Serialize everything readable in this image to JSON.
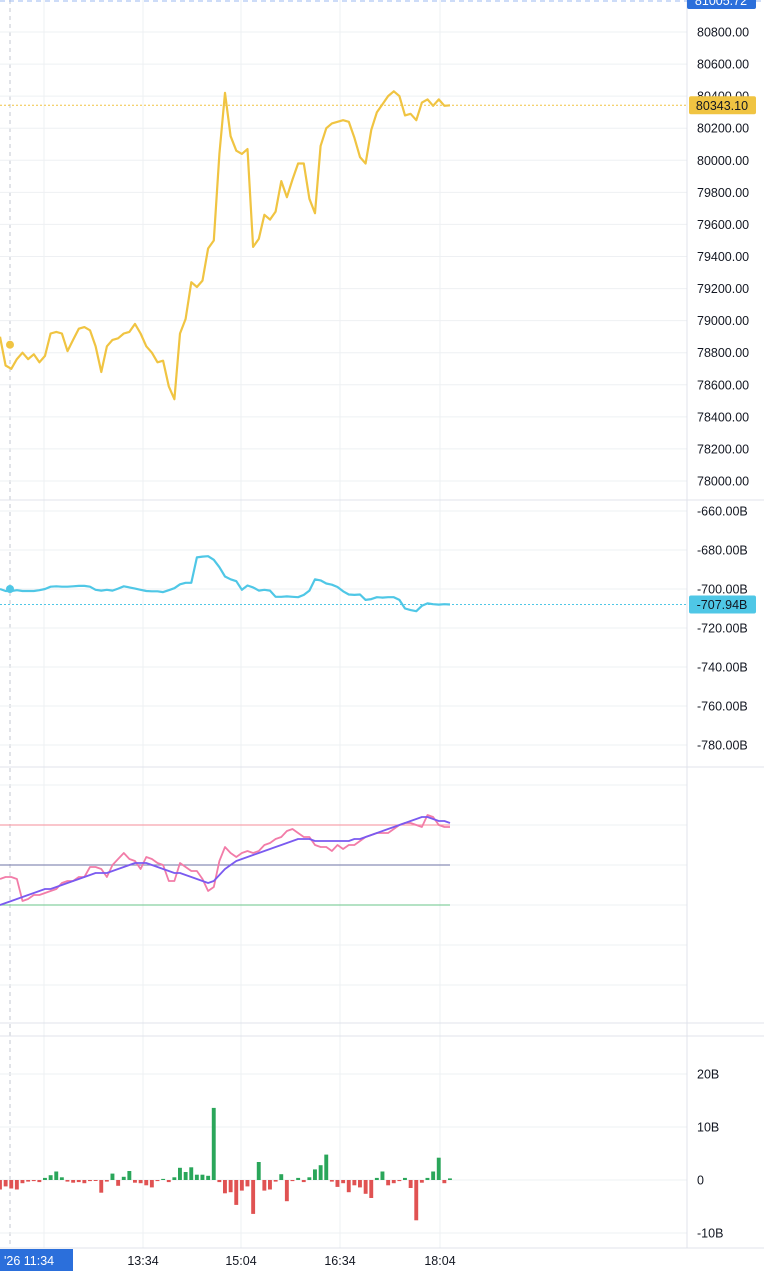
{
  "colors": {
    "price": "#f0c442",
    "flow": "#4fc7e6",
    "osc_fast": "#f27ca8",
    "osc_slow": "#7a5af0",
    "osc_upper": "#f7a3ad",
    "osc_mid": "#8a8fb8",
    "osc_lower": "#86d0a0",
    "hist_up": "#2aa65a",
    "hist_down": "#e05252",
    "grid": "#eef0f3",
    "tag_blue": "#2b6fdb"
  },
  "top_badge": "81005.72",
  "time_axis": {
    "cursor_label": "'26  11:34",
    "ticks": [
      "13:34",
      "15:04",
      "16:34",
      "18:04"
    ]
  },
  "chart_data": [
    {
      "type": "line",
      "pane": "price",
      "y_ticks": [
        "80800.00",
        "80600.00",
        "80400.00",
        "80200.00",
        "80000.00",
        "79800.00",
        "79600.00",
        "79400.00",
        "79200.00",
        "79000.00",
        "78800.00",
        "78600.00",
        "78400.00",
        "78200.00",
        "78000.00"
      ],
      "ylim": [
        77900,
        81000
      ],
      "last_value_label": "80343.10",
      "last_value": 80343.1,
      "values": [
        78900,
        78720,
        78700,
        78760,
        78800,
        78760,
        78790,
        78740,
        78780,
        78920,
        78930,
        78920,
        78810,
        78880,
        78950,
        78960,
        78940,
        78840,
        78680,
        78840,
        78880,
        78890,
        78920,
        78930,
        78980,
        78920,
        78840,
        78800,
        78740,
        78750,
        78590,
        78510,
        78920,
        79010,
        79240,
        79210,
        79250,
        79450,
        79500,
        80040,
        80420,
        80150,
        80060,
        80040,
        80070,
        79460,
        79510,
        79660,
        79630,
        79680,
        79870,
        79770,
        79880,
        79980,
        79980,
        79760,
        79670,
        80090,
        80200,
        80230,
        80240,
        80250,
        80240,
        80140,
        80020,
        79980,
        80190,
        80300,
        80350,
        80400,
        80430,
        80400,
        80280,
        80290,
        80250,
        80360,
        80380,
        80340,
        80380,
        80340,
        80343
      ]
    },
    {
      "type": "line",
      "pane": "flow",
      "y_ticks": [
        "-660.00B",
        "-680.00B",
        "-700.00B",
        "-720.00B",
        "-740.00B",
        "-760.00B",
        "-780.00B"
      ],
      "ylim": [
        -787,
        -655
      ],
      "last_value_label": "-707.94B",
      "last_value": -707.94,
      "values": [
        -700,
        -701,
        -701,
        -700.6,
        -701,
        -701,
        -701,
        -700.6,
        -700,
        -698.8,
        -698.6,
        -698.8,
        -698.8,
        -698.6,
        -698.4,
        -698.4,
        -698.8,
        -700.4,
        -700.8,
        -700.4,
        -700.8,
        -699.8,
        -698.6,
        -699.2,
        -699.8,
        -700.4,
        -701,
        -701.2,
        -701.2,
        -701.6,
        -700.6,
        -699.6,
        -697.6,
        -696.8,
        -696.8,
        -683.8,
        -683.4,
        -683.2,
        -685,
        -688.8,
        -693.6,
        -695,
        -696,
        -700.4,
        -698.2,
        -699.2,
        -700.8,
        -700.4,
        -700.8,
        -704,
        -704,
        -703.8,
        -704,
        -704.2,
        -703,
        -700.8,
        -695,
        -695.6,
        -697.2,
        -697.8,
        -699,
        -701.2,
        -702.8,
        -703,
        -702.8,
        -705.6,
        -705.2,
        -704.2,
        -704.4,
        -704.2,
        -704.2,
        -705.6,
        -710,
        -710.8,
        -711.4,
        -708.6,
        -707.4,
        -707.8,
        -708,
        -707.8,
        -707.94
      ]
    },
    {
      "type": "line",
      "pane": "oscillator",
      "series": [
        {
          "values": [
            63,
            64,
            64,
            63,
            52,
            53,
            55,
            55,
            56,
            57,
            58,
            61,
            62,
            62,
            64,
            64,
            69,
            69,
            68,
            64,
            70,
            73,
            76,
            73,
            72,
            68,
            74,
            73,
            71,
            70,
            62,
            62,
            71,
            69,
            67,
            67,
            63,
            57,
            59,
            72,
            79,
            76,
            74,
            76,
            77,
            76,
            77,
            80,
            81,
            83,
            84,
            87,
            88,
            86,
            84,
            84,
            80,
            79,
            79,
            77,
            80,
            78,
            80,
            80,
            82,
            84,
            85,
            86,
            86,
            86,
            88,
            90,
            91,
            91,
            90,
            89,
            95,
            94,
            90,
            89,
            89
          ]
        },
        {
          "values": [
            50,
            51,
            52,
            53,
            54,
            55,
            56,
            57,
            58,
            58,
            59,
            60,
            61,
            62,
            63,
            64,
            65,
            66,
            66,
            66,
            67,
            68,
            69,
            70,
            71,
            71,
            71,
            70,
            69,
            68,
            67,
            66,
            66,
            65,
            64,
            63,
            62,
            61,
            62,
            65,
            68,
            70,
            72,
            73,
            74,
            75,
            76,
            77,
            78,
            79,
            80,
            81,
            82,
            83,
            83,
            83,
            82,
            82,
            82,
            82,
            82,
            82,
            82,
            83,
            83,
            84,
            85,
            86,
            87,
            88,
            89,
            90,
            91,
            92,
            93,
            94,
            94,
            93,
            92,
            92,
            91
          ]
        }
      ],
      "levels": [
        90,
        70,
        50
      ],
      "ylim": [
        20,
        100
      ]
    },
    {
      "type": "bar",
      "pane": "histogram",
      "y_ticks": [
        "20B",
        "10B",
        "0",
        "-10B"
      ],
      "ylim": [
        -11.5,
        23.5
      ],
      "values": [
        -1.8,
        -1.2,
        -1.6,
        -1.8,
        -0.6,
        -0.3,
        -0.2,
        -0.4,
        0.4,
        0.9,
        1.6,
        0.5,
        -0.3,
        -0.5,
        -0.4,
        -0.6,
        -0.2,
        -0.1,
        -2.4,
        -0.3,
        1.2,
        -1.1,
        0.6,
        1.7,
        -0.5,
        -0.6,
        -1.0,
        -1.4,
        -0.2,
        0.2,
        -0.4,
        0.5,
        2.3,
        1.5,
        2.4,
        1.0,
        1.0,
        0.8,
        13.6,
        -0.4,
        -2.5,
        -2.3,
        -4.7,
        -2.0,
        -1.2,
        -6.4,
        3.4,
        -2.0,
        -1.8,
        -0.3,
        1.1,
        -4.0,
        -0.2,
        0.4,
        -0.4,
        0.5,
        2.0,
        2.8,
        4.8,
        -0.3,
        -1.3,
        -0.6,
        -2.3,
        -1.0,
        -1.4,
        -2.6,
        -3.4,
        0.4,
        1.6,
        -1.0,
        -0.6,
        -0.2,
        0.4,
        -1.5,
        -7.6,
        -0.5,
        0.4,
        1.6,
        4.2,
        -0.6,
        0.3
      ]
    }
  ]
}
